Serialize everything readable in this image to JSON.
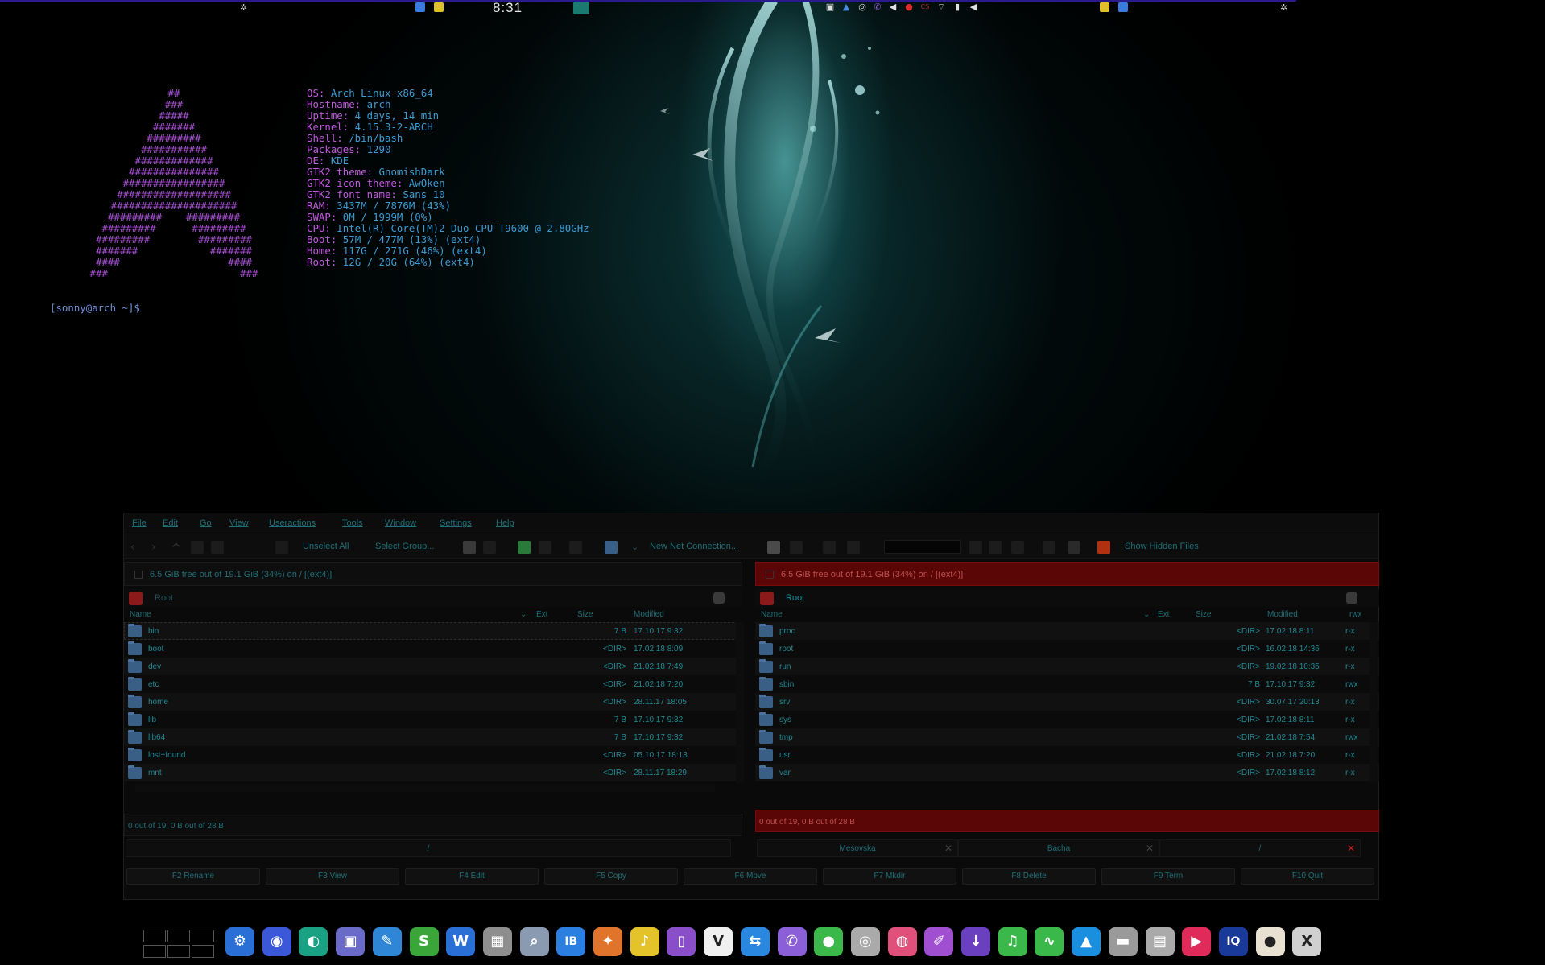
{
  "top_panel": {
    "clock": "8:31"
  },
  "terminal": {
    "logo": [
      "##",
      "###",
      "#####",
      "#######",
      "#########",
      "###########",
      "#############",
      "###############",
      "#################",
      "###################",
      "#####################",
      "#########    #########",
      "#########      #########",
      "#########        #########",
      "#######            #######",
      "####                  ####",
      "###                      ###"
    ],
    "info": [
      {
        "key": "OS:",
        "value": " Arch Linux x86_64"
      },
      {
        "key": "Hostname:",
        "value": " arch"
      },
      {
        "key": "Uptime:",
        "value": " 4 days, 14 min"
      },
      {
        "key": "Kernel:",
        "value": " 4.15.3-2-ARCH"
      },
      {
        "key": "Shell:",
        "value": " /bin/bash"
      },
      {
        "key": "Packages:",
        "value": " 1290"
      },
      {
        "key": "DE:",
        "value": " KDE"
      },
      {
        "key": "GTK2 theme:",
        "value": " GnomishDark"
      },
      {
        "key": "GTK2 icon theme:",
        "value": " AwOken"
      },
      {
        "key": "GTK2 font name:",
        "value": " Sans 10"
      },
      {
        "key": "RAM:",
        "value": " 3437M / 7876M (43%)"
      },
      {
        "key": "SWAP:",
        "value": " 0M / 1999M (0%)"
      },
      {
        "key": "CPU:",
        "value": " Intel(R) Core(TM)2 Duo CPU T9600 @ 2.80GHz"
      },
      {
        "key": "Boot:",
        "value": " 57M / 477M (13%) (ext4)"
      },
      {
        "key": "Home:",
        "value": " 117G / 271G (46%) (ext4)"
      },
      {
        "key": "Root:",
        "value": " 12G / 20G (64%) (ext4)"
      }
    ],
    "prompt": "[sonny@arch ~]$"
  },
  "file_manager": {
    "menu": [
      "File",
      "Edit",
      "Go",
      "View",
      "Useractions",
      "Tools",
      "Window",
      "Settings",
      "Help"
    ],
    "toolbar": {
      "unselect_all": "Unselect All",
      "select_group": "Select Group...",
      "new_net_connection": "New Net Connection...",
      "show_hidden_files": "Show Hidden Files"
    },
    "left": {
      "disk_info": "6.5 GiB free out of 19.1 GiB (34%) on / [(ext4)]",
      "path": "Root",
      "columns": {
        "name": "Name",
        "ext": "Ext",
        "size": "Size",
        "modified": "Modified"
      },
      "rows": [
        {
          "name": "bin",
          "size": "7 B",
          "modified": "17.10.17 9:32"
        },
        {
          "name": "boot",
          "size": "<DIR>",
          "modified": "17.02.18 8:09"
        },
        {
          "name": "dev",
          "size": "<DIR>",
          "modified": "21.02.18 7:49"
        },
        {
          "name": "etc",
          "size": "<DIR>",
          "modified": "21.02.18 7:20"
        },
        {
          "name": "home",
          "size": "<DIR>",
          "modified": "28.11.17 18:05"
        },
        {
          "name": "lib",
          "size": "7 B",
          "modified": "17.10.17 9:32"
        },
        {
          "name": "lib64",
          "size": "7 B",
          "modified": "17.10.17 9:32"
        },
        {
          "name": "lost+found",
          "size": "<DIR>",
          "modified": "05.10.17 18:13"
        },
        {
          "name": "mnt",
          "size": "<DIR>",
          "modified": "28.11.17 18:29"
        }
      ],
      "status": "0 out of 19, 0 B out of 28 B"
    },
    "right": {
      "disk_info": "6.5 GiB free out of 19.1 GiB (34%) on / [(ext4)]",
      "path": "Root",
      "columns": {
        "name": "Name",
        "ext": "Ext",
        "size": "Size",
        "modified": "Modified",
        "perms": "rwx"
      },
      "rows": [
        {
          "name": "proc",
          "size": "<DIR>",
          "modified": "17.02.18 8:11",
          "perms": "r-x"
        },
        {
          "name": "root",
          "size": "<DIR>",
          "modified": "16.02.18 14:36",
          "perms": "r-x"
        },
        {
          "name": "run",
          "size": "<DIR>",
          "modified": "19.02.18 10:35",
          "perms": "r-x"
        },
        {
          "name": "sbin",
          "size": "7 B",
          "modified": "17.10.17 9:32",
          "perms": "rwx"
        },
        {
          "name": "srv",
          "size": "<DIR>",
          "modified": "30.07.17 20:13",
          "perms": "r-x"
        },
        {
          "name": "sys",
          "size": "<DIR>",
          "modified": "17.02.18 8:11",
          "perms": "r-x"
        },
        {
          "name": "tmp",
          "size": "<DIR>",
          "modified": "21.02.18 7:54",
          "perms": "rwx"
        },
        {
          "name": "usr",
          "size": "<DIR>",
          "modified": "21.02.18 7:20",
          "perms": "r-x"
        },
        {
          "name": "var",
          "size": "<DIR>",
          "modified": "17.02.18 8:12",
          "perms": "r-x"
        }
      ],
      "status": "0 out of 19, 0 B out of 28 B"
    },
    "tabs_left": [
      "/"
    ],
    "tabs_right": [
      "Mesovska",
      "Bacha",
      "/"
    ],
    "fkeys": [
      "F2 Rename",
      "F3 View",
      "F4 Edit",
      "F5 Copy",
      "F6 Move",
      "F7 Mkdir",
      "F8 Delete",
      "F9 Term",
      "F10 Quit"
    ]
  },
  "dock": {
    "icons": [
      {
        "name": "settings-icon",
        "color": "#2a6fd6",
        "glyph": "⚙"
      },
      {
        "name": "firefox-icon",
        "color": "#3b58d8",
        "glyph": "◉"
      },
      {
        "name": "browser-icon",
        "color": "#1aa083",
        "glyph": "◐"
      },
      {
        "name": "screenshot-icon",
        "color": "#6a6ac8",
        "glyph": "▣"
      },
      {
        "name": "editor-icon",
        "color": "#2f86d6",
        "glyph": "✎"
      },
      {
        "name": "spreadsheet-icon",
        "color": "#3aa63a",
        "glyph": "S"
      },
      {
        "name": "writer-icon",
        "color": "#2a6fd6",
        "glyph": "W"
      },
      {
        "name": "calculator-icon",
        "color": "#8e8e8e",
        "glyph": "▦"
      },
      {
        "name": "search-icon",
        "color": "#8a9ab0",
        "glyph": "⌕"
      },
      {
        "name": "ib-icon",
        "color": "#2a7fe0",
        "glyph": "IB"
      },
      {
        "name": "gimp-icon",
        "color": "#e0742a",
        "glyph": "✦"
      },
      {
        "name": "music-icon",
        "color": "#e3c22a",
        "glyph": "♪"
      },
      {
        "name": "book-icon",
        "color": "#8a4fc8",
        "glyph": "▯"
      },
      {
        "name": "vlc-icon",
        "color": "#f0f0f0",
        "glyph": "V"
      },
      {
        "name": "teamviewer-icon",
        "color": "#2a87e0",
        "glyph": "⇆"
      },
      {
        "name": "viber-icon",
        "color": "#8a5fd8",
        "glyph": "✆"
      },
      {
        "name": "chat-icon",
        "color": "#3bb84a",
        "glyph": "●"
      },
      {
        "name": "disk-icon",
        "color": "#aaaaaa",
        "glyph": "◎"
      },
      {
        "name": "palette-icon",
        "color": "#e0507a",
        "glyph": "◍"
      },
      {
        "name": "paint-icon",
        "color": "#a04fd0",
        "glyph": "✐"
      },
      {
        "name": "download-icon",
        "color": "#6a3fc0",
        "glyph": "↓"
      },
      {
        "name": "audio-icon",
        "color": "#3ab84a",
        "glyph": "♫"
      },
      {
        "name": "monitor-icon",
        "color": "#3ab84a",
        "glyph": "∿"
      },
      {
        "name": "arch-icon",
        "color": "#1a8fe0",
        "glyph": "▲"
      },
      {
        "name": "drive-icon",
        "color": "#9a9a9a",
        "glyph": "▬"
      },
      {
        "name": "file-icon",
        "color": "#aaaaaa",
        "glyph": "▤"
      },
      {
        "name": "media-icon",
        "color": "#e02a5a",
        "glyph": "▶"
      },
      {
        "name": "iq-icon",
        "color": "#1a3a9a",
        "glyph": "IQ"
      },
      {
        "name": "ball-icon",
        "color": "#e8e0d0",
        "glyph": "●"
      },
      {
        "name": "close-x-icon",
        "color": "#d0d0d0",
        "glyph": "X"
      }
    ]
  },
  "colors": {
    "accent": "#1f8a95",
    "alert_red": "#5a0606",
    "logo_purple": "#a44fd0"
  }
}
